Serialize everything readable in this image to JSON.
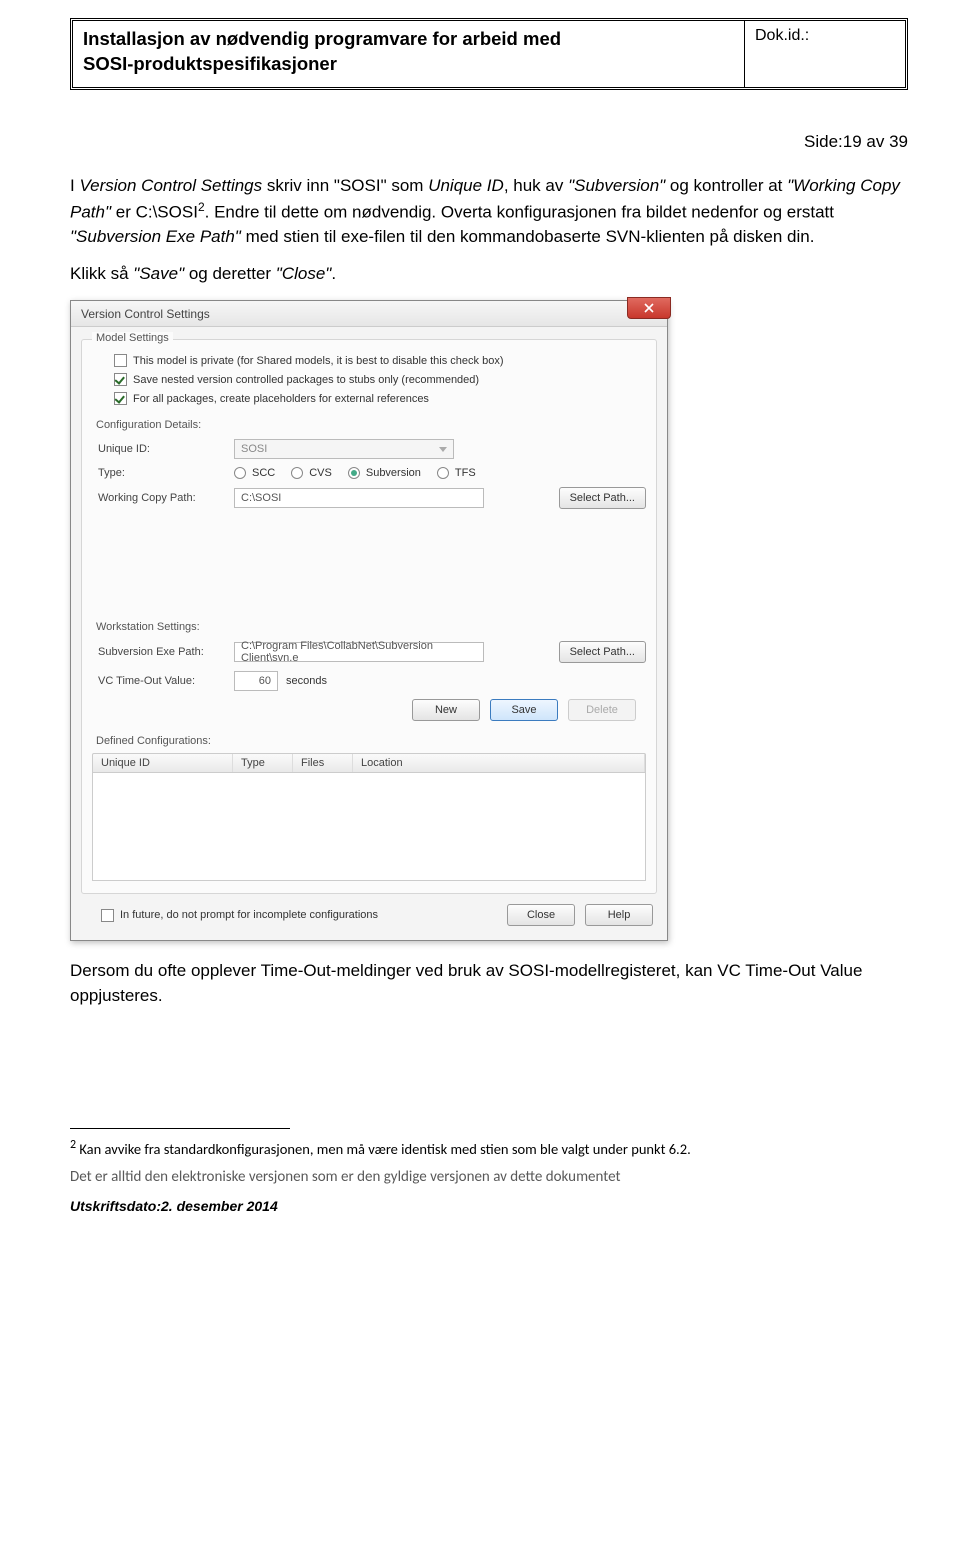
{
  "header": {
    "title_line1": "Installasjon av nødvendig programvare for arbeid med",
    "title_line2": "SOSI-produktspesifikasjoner",
    "dokid_label": "Dok.id.:"
  },
  "page_indicator": "Side:19 av 39",
  "para1_pre": "I ",
  "para1_vcs": "Version Control Settings",
  "para1_mid1": " skriv inn \"SOSI\" som ",
  "para1_uid": "Unique ID",
  "para1_mid2": ", huk av ",
  "para1_svn": "\"Subversion\"",
  "para1_mid3": " og kontroller at ",
  "para1_wcp": "\"Working Copy Path\"",
  "para1_mid4": " er C:\\SOSI",
  "para1_sup": "2",
  "para1_end": ". Endre til dette om nødvendig. Overta konfigurasjonen fra bildet nedenfor og erstatt ",
  "para1_sep": "\"Subversion Exe Path\"",
  "para1_end2": " med stien til exe-filen til den kommandobaserte SVN-klienten på disken din.",
  "para2_pre": "Klikk så ",
  "para2_save": "\"Save\"",
  "para2_mid": " og deretter ",
  "para2_close": "\"Close\"",
  "para2_end": ".",
  "dialog": {
    "title": "Version Control Settings",
    "group_model": "Model Settings",
    "chk_private": "This model is private (for Shared models, it is best to disable this check box)",
    "chk_nested": "Save nested version controlled packages to stubs only (recommended)",
    "chk_placeholders": "For all packages, create placeholders for external references",
    "config_details": "Configuration Details:",
    "uid_label": "Unique ID:",
    "uid_value": "SOSI",
    "type_label": "Type:",
    "type_scc": "SCC",
    "type_cvs": "CVS",
    "type_svn": "Subversion",
    "type_tfs": "TFS",
    "wcp_label": "Working Copy Path:",
    "wcp_value": "C:\\SOSI",
    "select_path": "Select Path...",
    "ws_label": "Workstation Settings:",
    "sep_label": "Subversion Exe Path:",
    "sep_value": "C:\\Program Files\\CollabNet\\Subversion Client\\svn.e",
    "to_label": "VC Time-Out Value:",
    "to_value": "60",
    "to_unit": "seconds",
    "btn_new": "New",
    "btn_save": "Save",
    "btn_delete": "Delete",
    "defconf": "Defined Configurations:",
    "col_uid": "Unique ID",
    "col_type": "Type",
    "col_files": "Files",
    "col_loc": "Location",
    "chk_future": "In future, do not prompt for incomplete configurations",
    "btn_close": "Close",
    "btn_help": "Help"
  },
  "below_pre": "Dersom du ofte opplever Time-Out-meldinger ved bruk av SOSI-modellregisteret, kan ",
  "below_it": "VC Time-Out Value",
  "below_end": " oppjusteres.",
  "footnote_sup": "2",
  "footnote_text": " Kan avvike fra standardkonfigurasjonen, men må være identisk med stien som ble valgt under punkt 6.2.",
  "gray_line": "Det er alltid den elektroniske versjonen som er den gyldige versjonen av dette dokumentet",
  "print_date": "Utskriftsdato:2. desember 2014"
}
